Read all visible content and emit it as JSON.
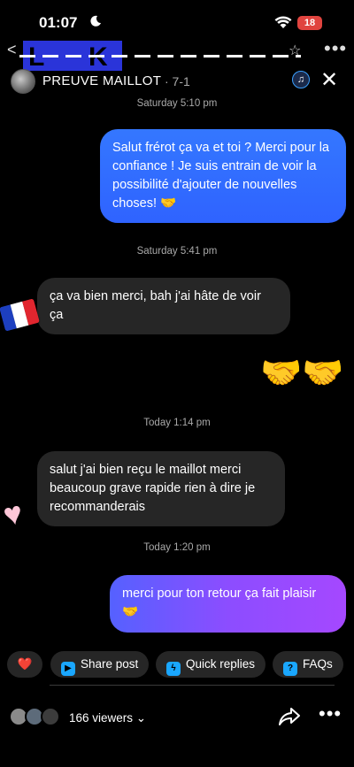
{
  "status_bar": {
    "time": "01:07",
    "battery": "18"
  },
  "header": {
    "title": "PREUVE MAILLOT",
    "subtitle": "· 7-1"
  },
  "messages": [
    {
      "timestamp": "Saturday 5:10 pm"
    },
    {
      "text": "Salut frérot ça va et toi ? Merci pour la confiance ! Je suis entrain de voir la possibilité d'ajouter de nouvelles choses! 🤝"
    },
    {
      "timestamp": "Saturday 5:41 pm"
    },
    {
      "text": "ça va bien merci, bah j'ai hâte de voir ça"
    },
    {
      "text": "🤝🤝"
    },
    {
      "timestamp": "Today 1:14 pm"
    },
    {
      "text": "salut j'ai bien reçu le maillot merci beaucoup grave rapide rien à dire je recommanderais"
    },
    {
      "timestamp": "Today 1:20 pm"
    },
    {
      "text": "merci pour ton retour ça fait plaisir 🤝"
    }
  ],
  "chips": {
    "like": "❤️",
    "share_post": "Share post",
    "quick_replies": "Quick replies",
    "faqs": "FAQs"
  },
  "viewers": {
    "count_label": "166 viewers ⌄"
  },
  "colors": {
    "outgoing_blue": "#3477ff",
    "outgoing_purple": "#a548ff",
    "incoming": "#262626",
    "background": "#000000"
  }
}
